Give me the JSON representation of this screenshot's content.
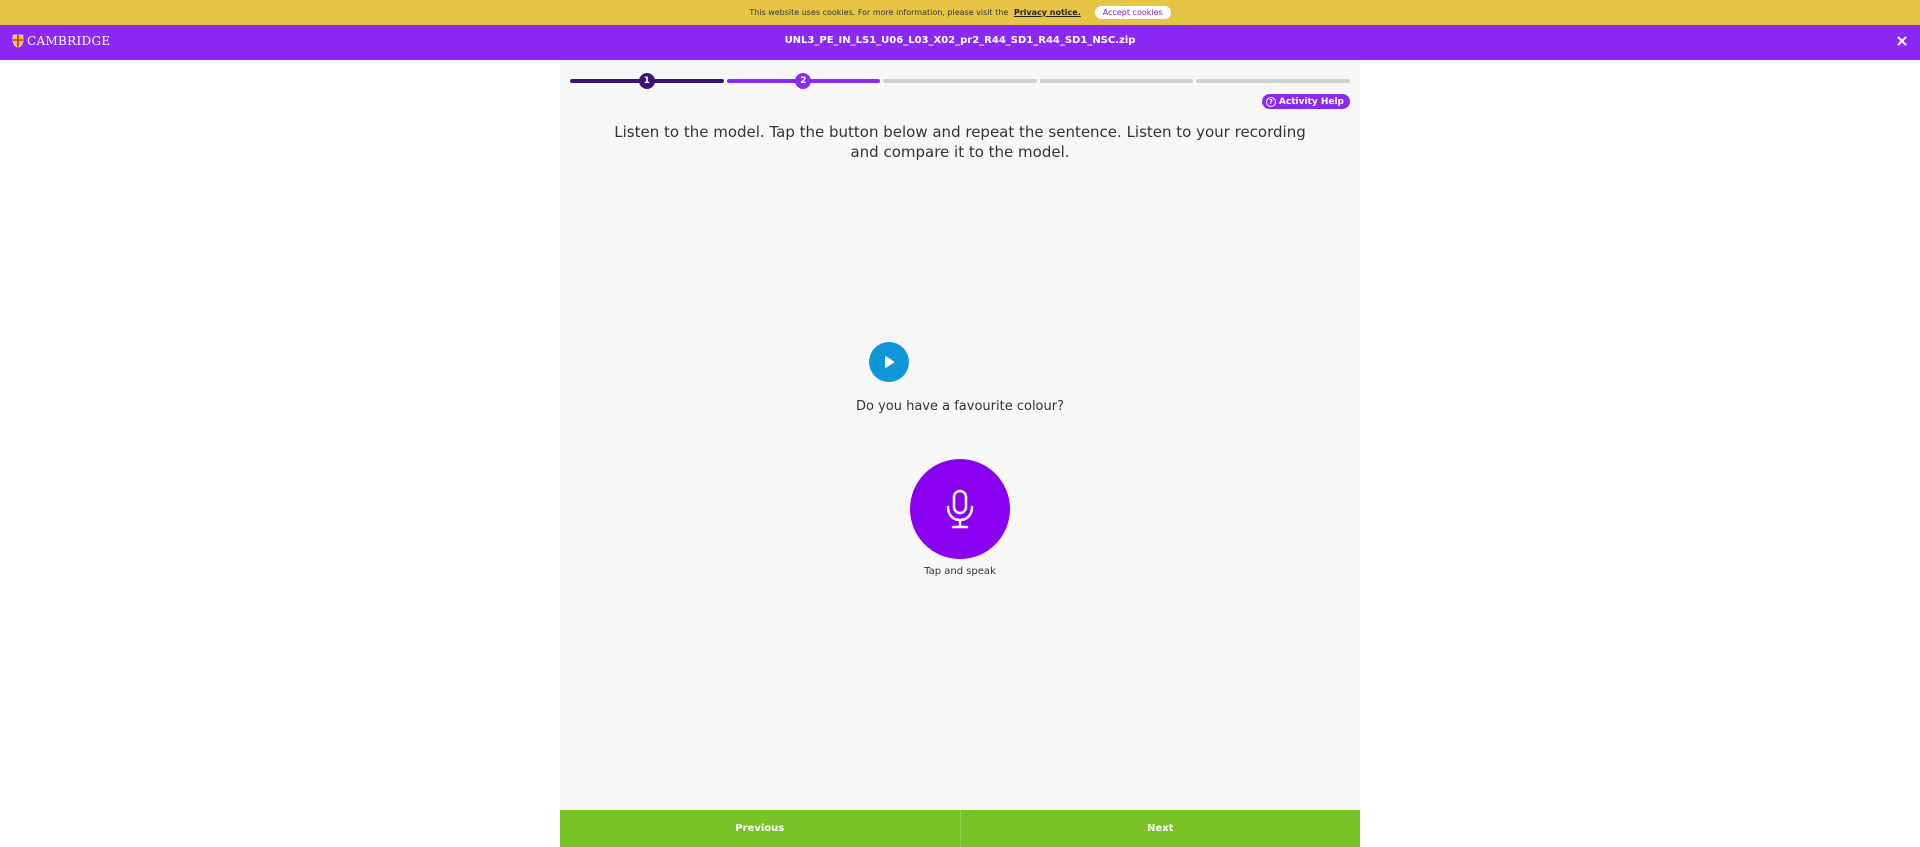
{
  "cookie_bar": {
    "text": "This website uses cookies. For more information, please visit the",
    "link": "Privacy notice.",
    "accept_label": "Accept cookies"
  },
  "header": {
    "logo_text": "CAMBRIDGE",
    "title": "UNL3_PE_IN_LS1_U06_L03_X02_pr2_R44_SD1_R44_SD1_NSC.zip",
    "close_icon": "close-icon"
  },
  "colors": {
    "cookie_bar": "#e6c446",
    "header": "#8a28f6",
    "progress_done": "#3c1478",
    "progress_active": "#8a28f6",
    "progress_pending": "#d0d0d0",
    "play_button": "#0e96d8",
    "mic_button": "#8a00f0",
    "footer": "#78c225"
  },
  "progress": {
    "steps": [
      {
        "label": "1",
        "state": "done"
      },
      {
        "label": "2",
        "state": "active"
      },
      {
        "label": "",
        "state": "pending"
      },
      {
        "label": "",
        "state": "pending"
      },
      {
        "label": "",
        "state": "pending"
      }
    ]
  },
  "activity": {
    "help_label": "Activity Help",
    "instruction": "Listen to the model. Tap the button below and repeat the sentence. Listen to your recording and compare it to the model.",
    "sentence": "Do you have a favourite colour?",
    "mic_label": "Tap and speak"
  },
  "footer": {
    "previous_label": "Previous",
    "next_label": "Next"
  }
}
